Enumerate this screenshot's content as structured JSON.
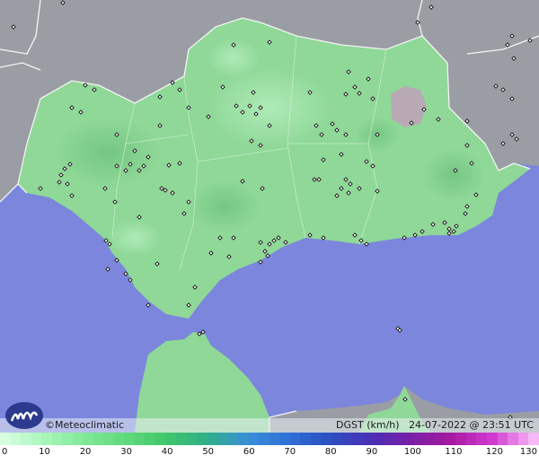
{
  "map": {
    "brand": "©Meteoclimatic",
    "variable": "DGST (km/h)",
    "timestamp": "24-07-2022 @ 23:51 UTC",
    "colors": {
      "sea": "#7b86dc",
      "land": "#8fd898",
      "land_dark": "#7ccc86",
      "outside_land": "#9a9ea4",
      "border": "#f2f2f2"
    }
  },
  "legend": {
    "labels": [
      "0",
      "10",
      "20",
      "30",
      "40",
      "50",
      "60",
      "70",
      "80",
      "90",
      "100",
      "110",
      "120",
      "130"
    ],
    "colors": [
      "#d6ffdf",
      "#a7f5b8",
      "#7ee896",
      "#5fd97b",
      "#3ec56a",
      "#2fae8a",
      "#3a8ed9",
      "#2f6fd6",
      "#2c4fc2",
      "#4a2fb5",
      "#7a1fa8",
      "#a81aa0",
      "#d23bd2",
      "#f6b8f6"
    ]
  }
}
